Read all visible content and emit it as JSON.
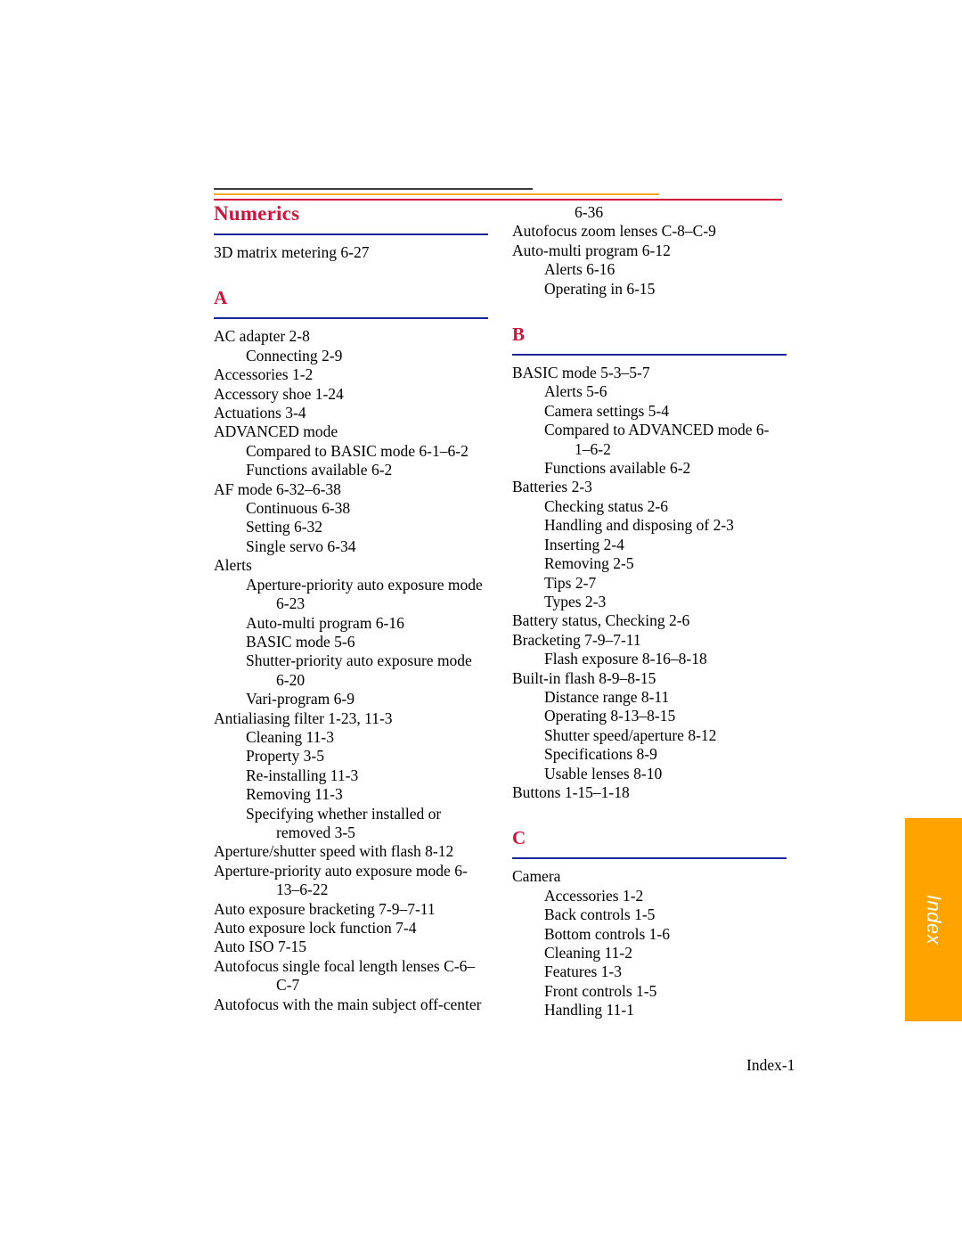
{
  "page": {
    "footer_page_label": "Index-1",
    "tab_label": "Index",
    "colors": {
      "heading_red": "#d2143c",
      "section_rule_blue": "#1c239b",
      "tab_orange": "#ffa300",
      "rule_dark": "#3b3b3b",
      "rule_orange": "#f9a41e",
      "rule_red": "#d2143c"
    }
  },
  "columns": {
    "left": {
      "sections": [
        {
          "heading": "Numerics",
          "entries": [
            {
              "level": 0,
              "text": "3D matrix metering 6-27"
            }
          ]
        },
        {
          "heading": "A",
          "entries": [
            {
              "level": 0,
              "text": "AC adapter 2-8"
            },
            {
              "level": 1,
              "text": "Connecting 2-9"
            },
            {
              "level": 0,
              "text": "Accessories 1-2"
            },
            {
              "level": 0,
              "text": "Accessory shoe 1-24"
            },
            {
              "level": 0,
              "text": "Actuations 3-4"
            },
            {
              "level": 0,
              "text": "ADVANCED mode"
            },
            {
              "level": 1,
              "text": "Compared to BASIC mode 6-1–6-2"
            },
            {
              "level": 1,
              "text": "Functions available 6-2"
            },
            {
              "level": 0,
              "text": "AF mode 6-32–6-38"
            },
            {
              "level": 1,
              "text": "Continuous 6-38"
            },
            {
              "level": 1,
              "text": "Setting 6-32"
            },
            {
              "level": 1,
              "text": "Single servo 6-34"
            },
            {
              "level": 0,
              "text": "Alerts"
            },
            {
              "level": 1,
              "text": "Aperture-priority auto exposure mode"
            },
            {
              "level": 2,
              "text": "6-23"
            },
            {
              "level": 1,
              "text": "Auto-multi program 6-16"
            },
            {
              "level": 1,
              "text": "BASIC mode 5-6"
            },
            {
              "level": 1,
              "text": "Shutter-priority auto exposure mode"
            },
            {
              "level": 2,
              "text": "6-20"
            },
            {
              "level": 1,
              "text": "Vari-program 6-9"
            },
            {
              "level": 0,
              "text": "Antialiasing filter 1-23, 11-3"
            },
            {
              "level": 1,
              "text": "Cleaning 11-3"
            },
            {
              "level": 1,
              "text": "Property 3-5"
            },
            {
              "level": 1,
              "text": "Re-installing 11-3"
            },
            {
              "level": 1,
              "text": "Removing 11-3"
            },
            {
              "level": 1,
              "text": "Specifying whether installed or"
            },
            {
              "level": 2,
              "text": "removed 3-5"
            },
            {
              "level": 0,
              "text": "Aperture/shutter speed with flash 8-12"
            },
            {
              "level": 0,
              "text": "Aperture-priority auto exposure mode 6-"
            },
            {
              "level": 2,
              "text": "13–6-22"
            },
            {
              "level": 0,
              "text": "Auto exposure bracketing 7-9–7-11"
            },
            {
              "level": 0,
              "text": "Auto exposure lock function 7-4"
            },
            {
              "level": 0,
              "text": "Auto ISO 7-15"
            },
            {
              "level": 0,
              "text": "Autofocus single focal length lenses C-6–"
            },
            {
              "level": 2,
              "text": "C-7"
            },
            {
              "level": 0,
              "text": "Autofocus with the main subject off-center"
            }
          ]
        }
      ]
    },
    "right": {
      "sections": [
        {
          "heading": "",
          "entries": [
            {
              "level": 2,
              "text": "6-36"
            },
            {
              "level": 0,
              "text": "Autofocus zoom lenses C-8–C-9"
            },
            {
              "level": 0,
              "text": "Auto-multi program 6-12"
            },
            {
              "level": 1,
              "text": "Alerts 6-16"
            },
            {
              "level": 1,
              "text": "Operating in 6-15"
            }
          ]
        },
        {
          "heading": "B",
          "entries": [
            {
              "level": 0,
              "text": "BASIC mode 5-3–5-7"
            },
            {
              "level": 1,
              "text": "Alerts 5-6"
            },
            {
              "level": 1,
              "text": "Camera settings 5-4"
            },
            {
              "level": 1,
              "text": "Compared to ADVANCED mode 6-"
            },
            {
              "level": 2,
              "text": "1–6-2"
            },
            {
              "level": 1,
              "text": "Functions available 6-2"
            },
            {
              "level": 0,
              "text": "Batteries 2-3"
            },
            {
              "level": 1,
              "text": "Checking status 2-6"
            },
            {
              "level": 1,
              "text": "Handling and disposing of 2-3"
            },
            {
              "level": 1,
              "text": "Inserting 2-4"
            },
            {
              "level": 1,
              "text": "Removing 2-5"
            },
            {
              "level": 1,
              "text": "Tips 2-7"
            },
            {
              "level": 1,
              "text": "Types 2-3"
            },
            {
              "level": 0,
              "text": "Battery status, Checking 2-6"
            },
            {
              "level": 0,
              "text": "Bracketing 7-9–7-11"
            },
            {
              "level": 1,
              "text": "Flash exposure 8-16–8-18"
            },
            {
              "level": 0,
              "text": "Built-in flash 8-9–8-15"
            },
            {
              "level": 1,
              "text": "Distance range 8-11"
            },
            {
              "level": 1,
              "text": "Operating 8-13–8-15"
            },
            {
              "level": 1,
              "text": "Shutter speed/aperture 8-12"
            },
            {
              "level": 1,
              "text": "Specifications 8-9"
            },
            {
              "level": 1,
              "text": "Usable lenses 8-10"
            },
            {
              "level": 0,
              "text": "Buttons 1-15–1-18"
            }
          ]
        },
        {
          "heading": "C",
          "entries": [
            {
              "level": 0,
              "text": "Camera"
            },
            {
              "level": 1,
              "text": "Accessories 1-2"
            },
            {
              "level": 1,
              "text": "Back controls 1-5"
            },
            {
              "level": 1,
              "text": "Bottom controls 1-6"
            },
            {
              "level": 1,
              "text": "Cleaning 11-2"
            },
            {
              "level": 1,
              "text": "Features 1-3"
            },
            {
              "level": 1,
              "text": "Front controls 1-5"
            },
            {
              "level": 1,
              "text": "Handling 11-1"
            }
          ]
        }
      ]
    }
  }
}
